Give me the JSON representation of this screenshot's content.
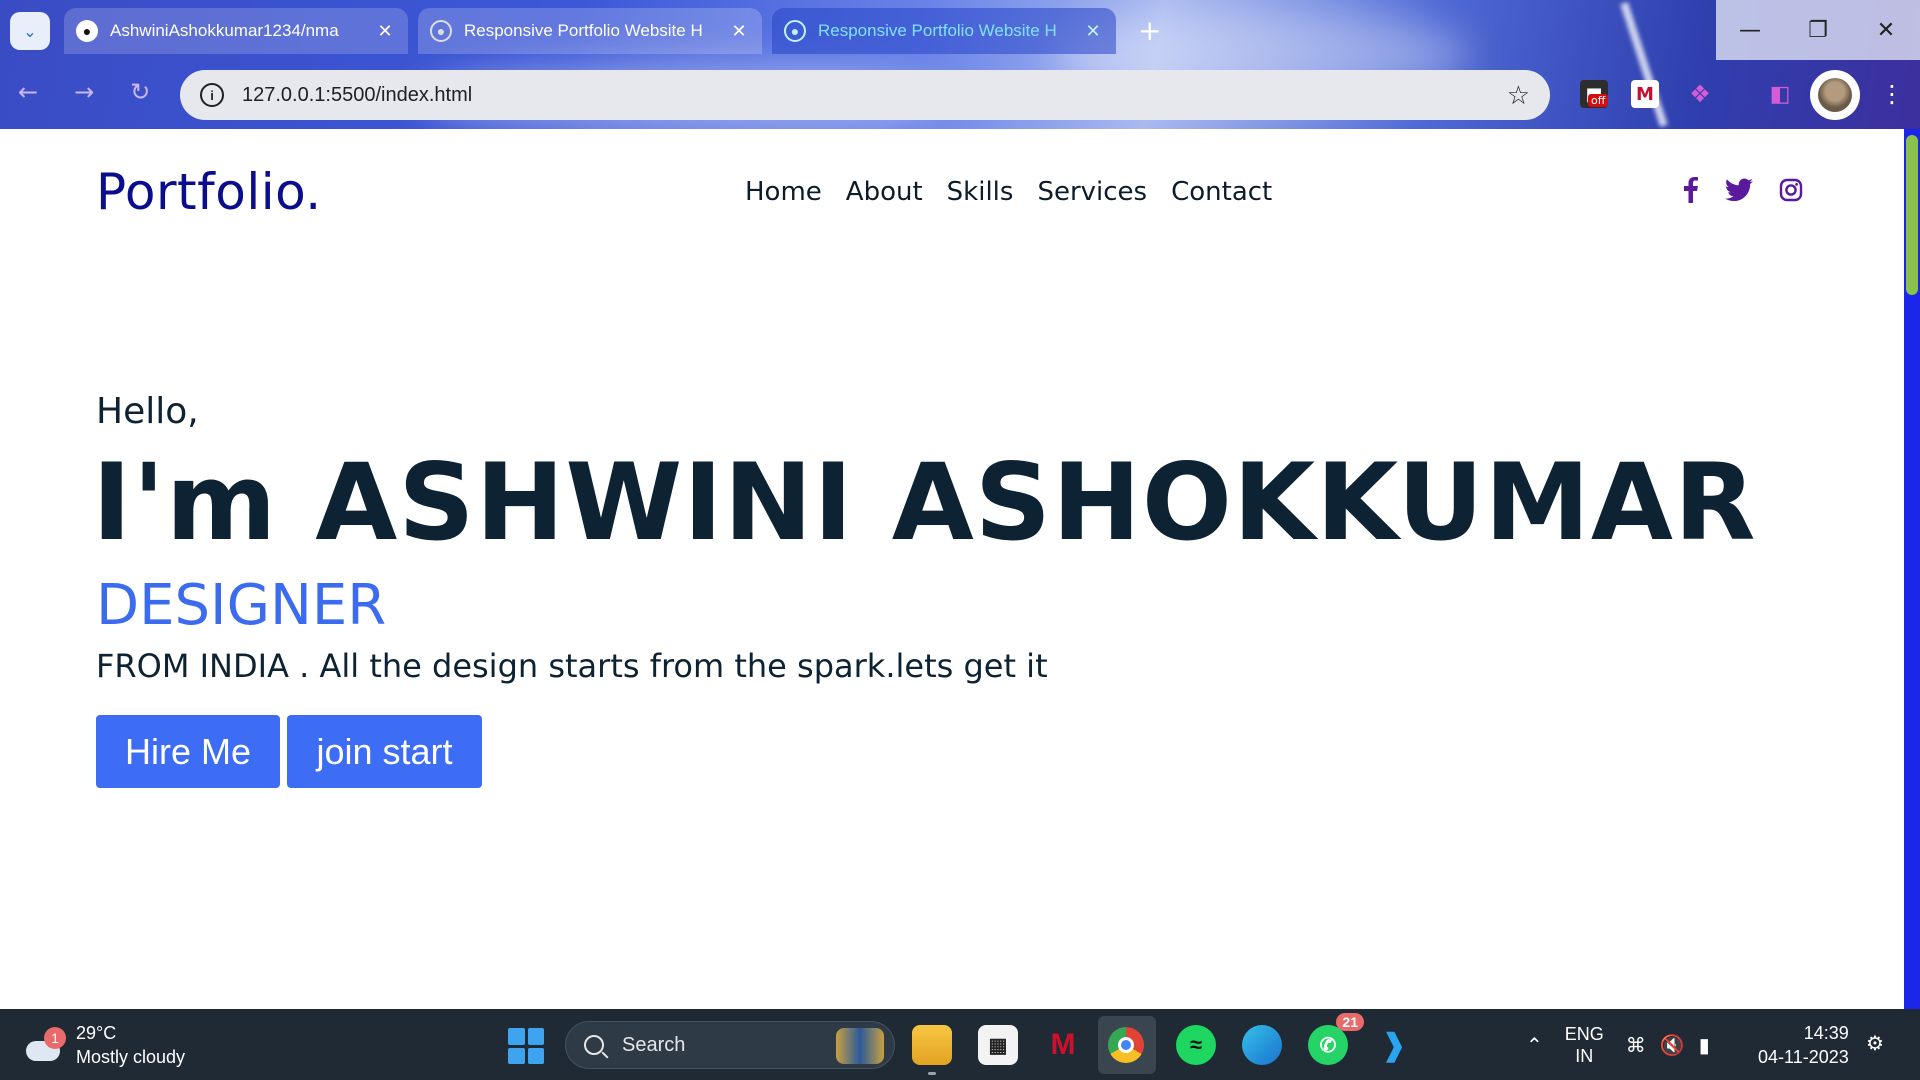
{
  "browser": {
    "tabs": [
      {
        "title": "AshwiniAshokkumar1234/nma",
        "icon": "github-icon",
        "active": false
      },
      {
        "title": "Responsive Portfolio Website H",
        "icon": "globe-icon",
        "active": false
      },
      {
        "title": "Responsive Portfolio Website H",
        "icon": "globe-icon",
        "active": true
      }
    ],
    "url": "127.0.0.1:5500/index.html",
    "extension_off_badge": "off",
    "accent_active_tab": "#7fe3ff"
  },
  "site": {
    "logo": "Portfolio.",
    "nav": [
      "Home",
      "About",
      "Skills",
      "Services",
      "Contact"
    ],
    "social_icons": [
      "facebook-icon",
      "twitter-icon",
      "instagram-icon"
    ],
    "hero": {
      "greeting": "Hello,",
      "name": "I'm ASHWINI ASHOKKUMAR",
      "role": "DESIGNER",
      "tagline": "FROM INDIA . All the design starts from the spark.lets get it",
      "buttons": [
        "Hire Me",
        "join start"
      ]
    },
    "colors": {
      "logo": "#0a0d8c",
      "heading": "#0d2233",
      "role": "#3b6cf0",
      "button": "#3d6cf5",
      "social": "#5b1a9e"
    }
  },
  "taskbar": {
    "weather_badge": "1",
    "temperature": "29°C",
    "condition": "Mostly cloudy",
    "search_placeholder": "Search",
    "whatsapp_badge": "21",
    "lang_line1": "ENG",
    "lang_line2": "IN",
    "time": "14:39",
    "date": "04-11-2023"
  }
}
